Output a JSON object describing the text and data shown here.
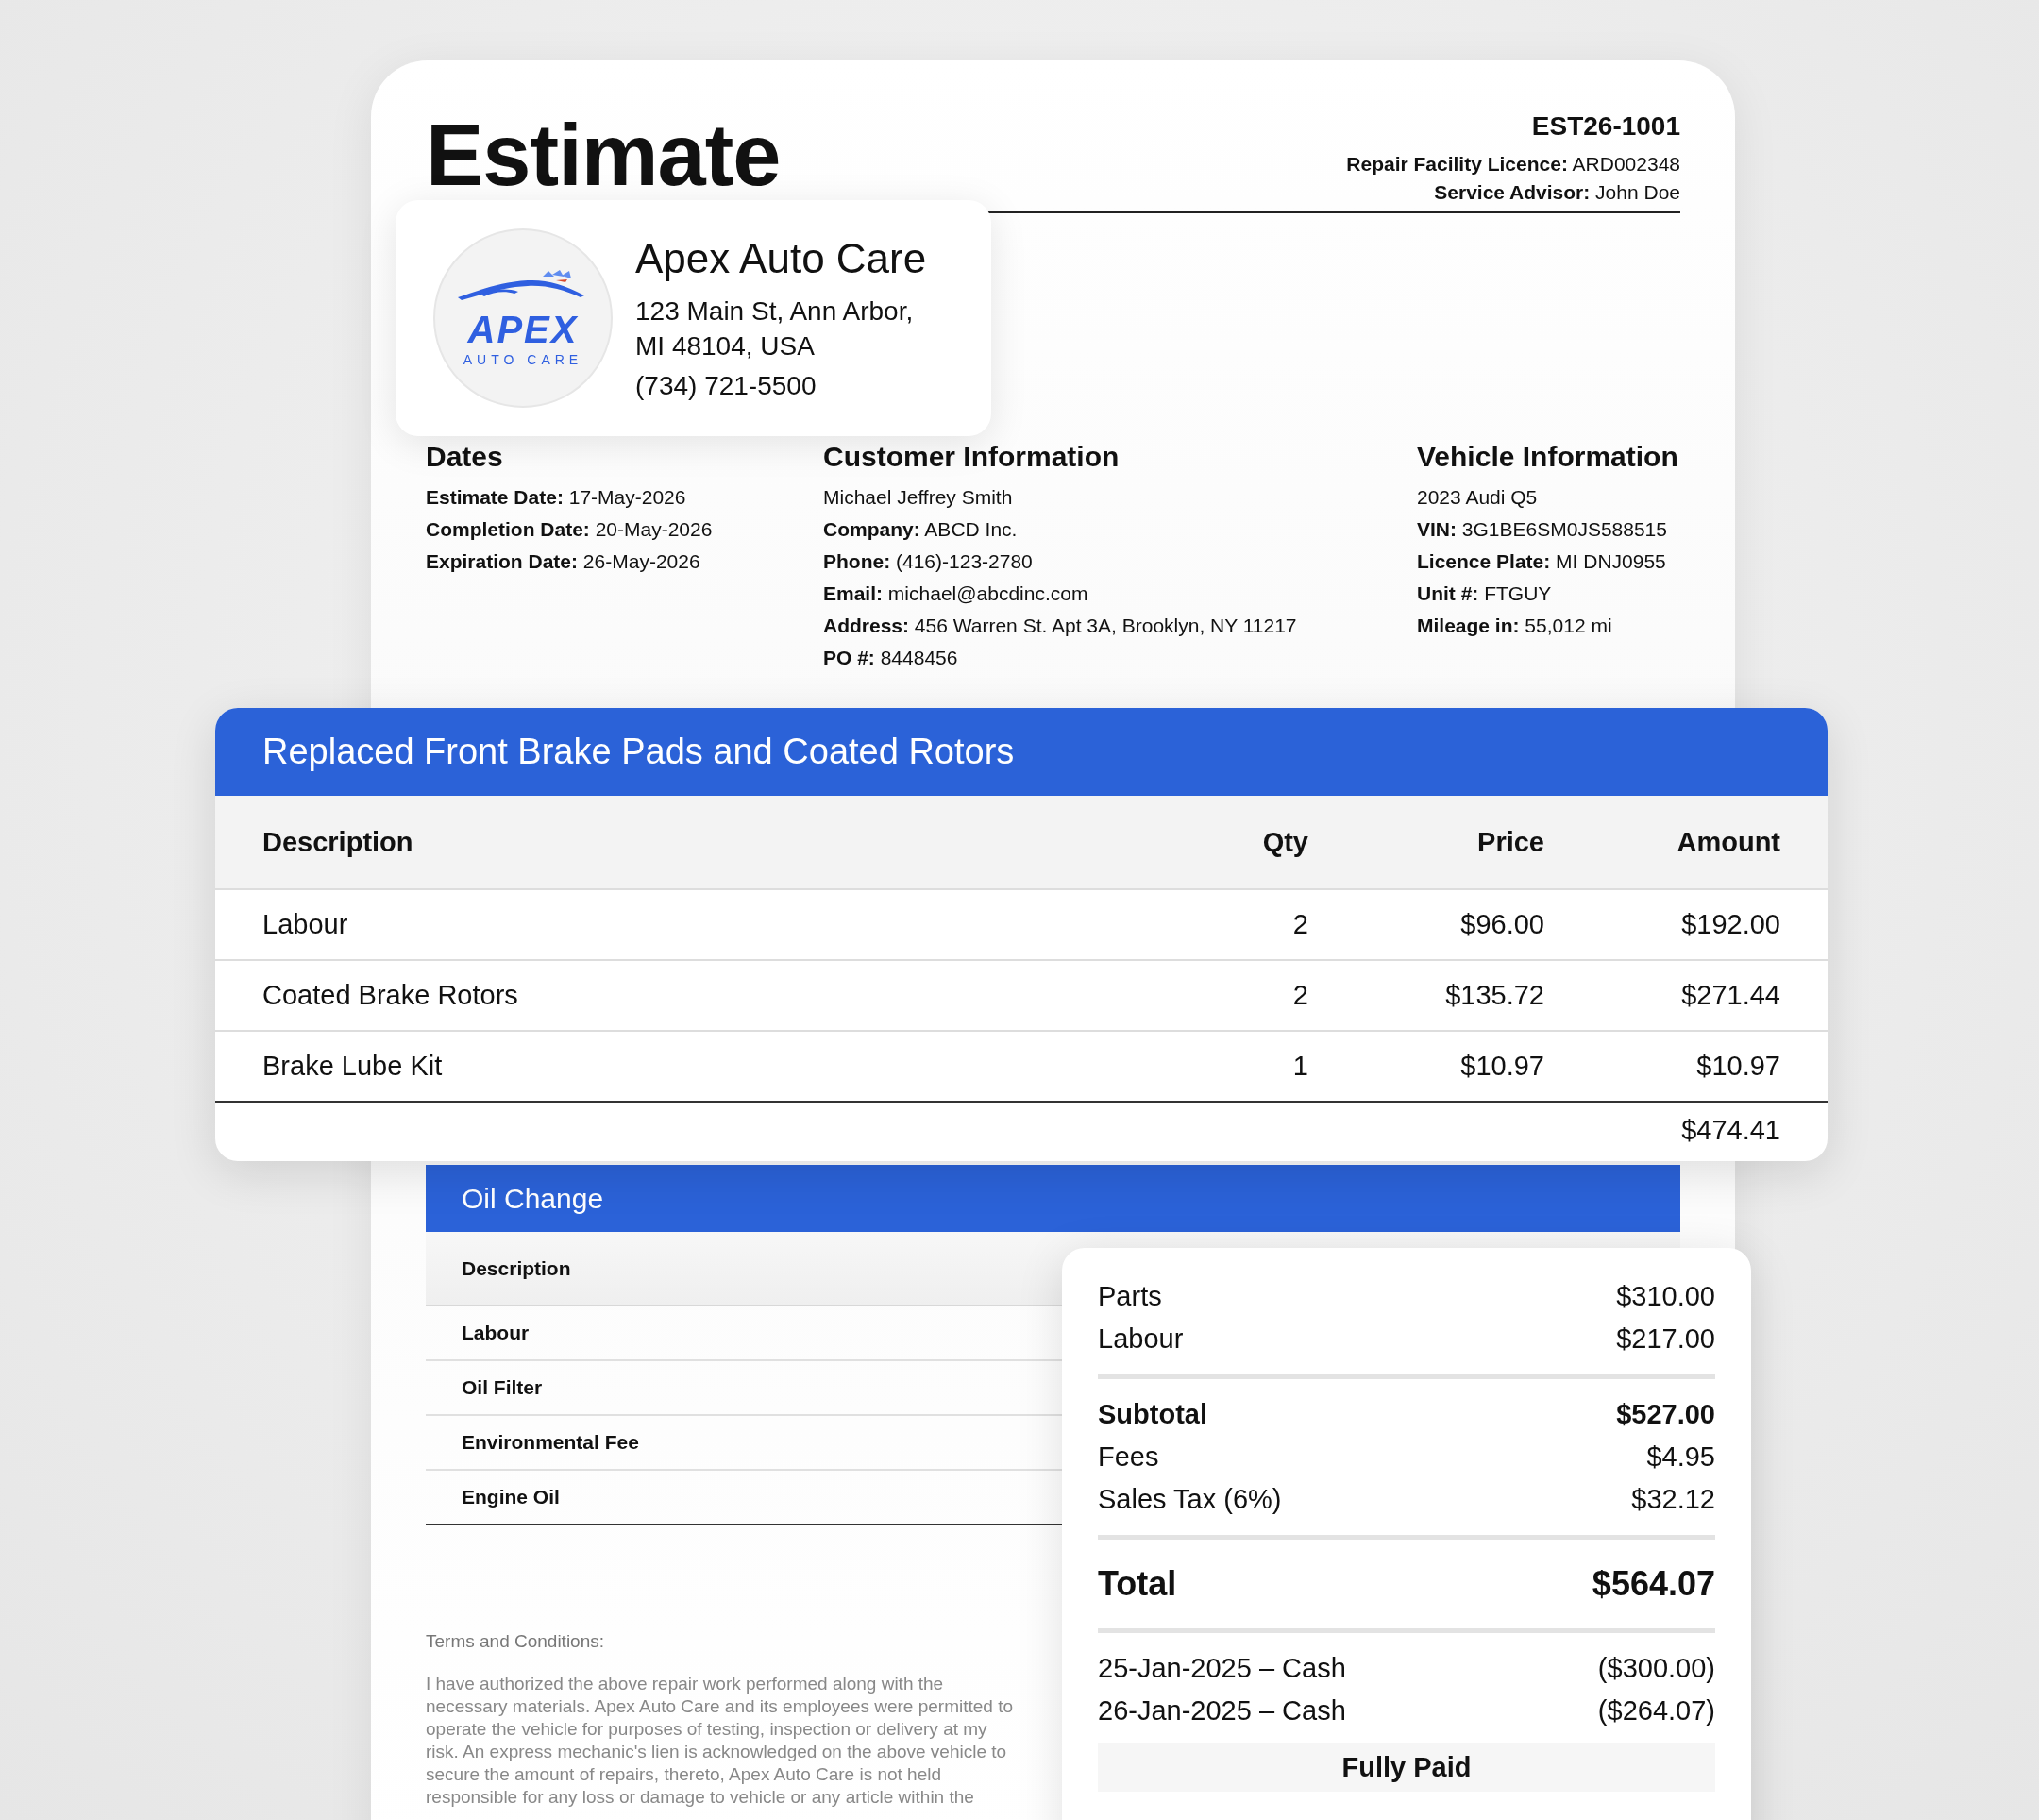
{
  "document": {
    "title": "Estimate",
    "number": "EST26-1001",
    "meta": [
      "**Repair Facility Licence:** ARD002348",
      "**Service Advisor:** John Doe"
    ]
  },
  "company": {
    "logo_word": "APEX",
    "logo_tagline": "AUTO CARE",
    "name": "Apex Auto Care",
    "address": [
      "123 Main St, Ann Arbor,",
      "MI 48104, USA"
    ],
    "phone": "(734) 721-5500"
  },
  "info": [
    {
      "heading": "Dates",
      "lines": [
        "**Estimate Date:** 17-May-2026",
        "**Completion Date:** 20-May-2026",
        "**Expiration Date:** 26-May-2026"
      ]
    },
    {
      "heading": "Customer Information",
      "lines": [
        "Michael Jeffrey Smith",
        "**Company:** ABCD Inc.",
        "**Phone:** (416)-123-2780",
        "**Email:** michael@abcdinc.com",
        "**Address:** 456 Warren St. Apt 3A, Brooklyn, NY 11217",
        "**PO #:** 8448456"
      ]
    },
    {
      "heading": "Vehicle Information",
      "lines": [
        "2023 Audi Q5",
        "**VIN:** 3G1BE6SM0JS588515",
        "**Licence Plate:** MI DNJ0955",
        "**Unit #:** FTGUY",
        "**Mileage in:** 55,012 mi"
      ]
    }
  ],
  "job": {
    "title": "Replaced Front Brake Pads and Coated Rotors",
    "columns": [
      "Description",
      "Qty",
      "Price",
      "Amount"
    ],
    "rows": [
      {
        "description": "Labour",
        "qty": "2",
        "price": "$96.00",
        "amount": "$192.00"
      },
      {
        "description": "Coated Brake Rotors",
        "qty": "2",
        "price": "$135.72",
        "amount": "$271.44"
      },
      {
        "description": "Brake Lube Kit",
        "qty": "1",
        "price": "$10.97",
        "amount": "$10.97"
      }
    ],
    "total": "$474.41"
  },
  "oil_change": {
    "title": "Oil Change",
    "columns": [
      "Description"
    ],
    "rows": [
      "Labour",
      "Oil Filter",
      "Environmental Fee",
      "Engine Oil"
    ]
  },
  "terms": {
    "heading": "Terms and Conditions:",
    "text": "I have authorized the above repair work performed along with the necessary materials. Apex Auto Care and its employees were permitted to operate the vehicle for purposes of testing, inspection or delivery at my risk. An express mechanic's lien is acknowledged on the above vehicle to secure the amount of repairs,  thereto, Apex Auto Care is not held responsible for any loss or damage to vehicle or any article within the"
  },
  "summary": {
    "groups": [
      [
        {
          "kind": "line",
          "label": "Parts",
          "amount": "$310.00"
        },
        {
          "kind": "line",
          "label": "Labour",
          "amount": "$217.00"
        }
      ],
      [
        {
          "kind": "subtotal",
          "label": "Subtotal",
          "amount": "$527.00"
        },
        {
          "kind": "line",
          "label": "Fees",
          "amount": "$4.95"
        },
        {
          "kind": "line",
          "label": "Sales Tax (6%)",
          "amount": "$32.12"
        }
      ],
      [
        {
          "kind": "total",
          "label": "Total",
          "amount": "$564.07"
        }
      ],
      [
        {
          "kind": "payment",
          "label": "25-Jan-2025 – Cash",
          "amount": "($300.00)"
        },
        {
          "kind": "payment",
          "label": "26-Jan-2025 – Cash",
          "amount": "($264.07)"
        }
      ]
    ],
    "status": "Fully Paid"
  }
}
